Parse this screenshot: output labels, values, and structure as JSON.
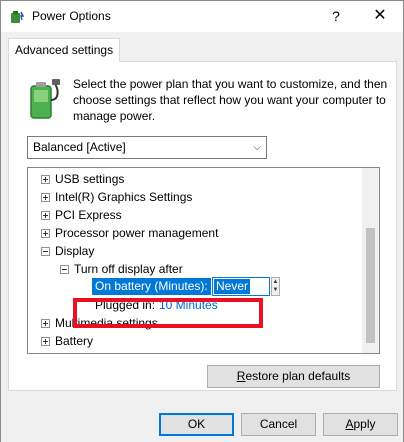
{
  "window": {
    "title": "Power Options",
    "help_glyph": "?",
    "close_glyph": "✕",
    "icon": "power-options-icon"
  },
  "tab": {
    "label": "Advanced settings"
  },
  "description": "Select the power plan that you want to customize, and then choose settings that reflect how you want your computer to manage power.",
  "plan": {
    "selected": "Balanced [Active]"
  },
  "tree": {
    "items": [
      {
        "label": "USB settings",
        "expanded": false
      },
      {
        "label": "Intel(R) Graphics Settings",
        "expanded": false
      },
      {
        "label": "PCI Express",
        "expanded": false
      },
      {
        "label": "Processor power management",
        "expanded": false
      },
      {
        "label": "Display",
        "expanded": true
      },
      {
        "label": "Turn off display after",
        "expanded": true
      },
      {
        "label": "On battery (Minutes):",
        "value": "Never"
      },
      {
        "label": "Plugged in:",
        "value": "10 Minutes"
      },
      {
        "label": "Multimedia settings",
        "expanded": false
      },
      {
        "label": "Battery",
        "expanded": false
      }
    ]
  },
  "buttons": {
    "restore_prefix": "R",
    "restore_rest": "estore plan defaults",
    "ok": "OK",
    "cancel": "Cancel",
    "apply_prefix": "A",
    "apply_rest": "pply"
  },
  "colors": {
    "selection": "#0078d7",
    "highlight_box": "#e81123",
    "link": "#0066cc"
  }
}
